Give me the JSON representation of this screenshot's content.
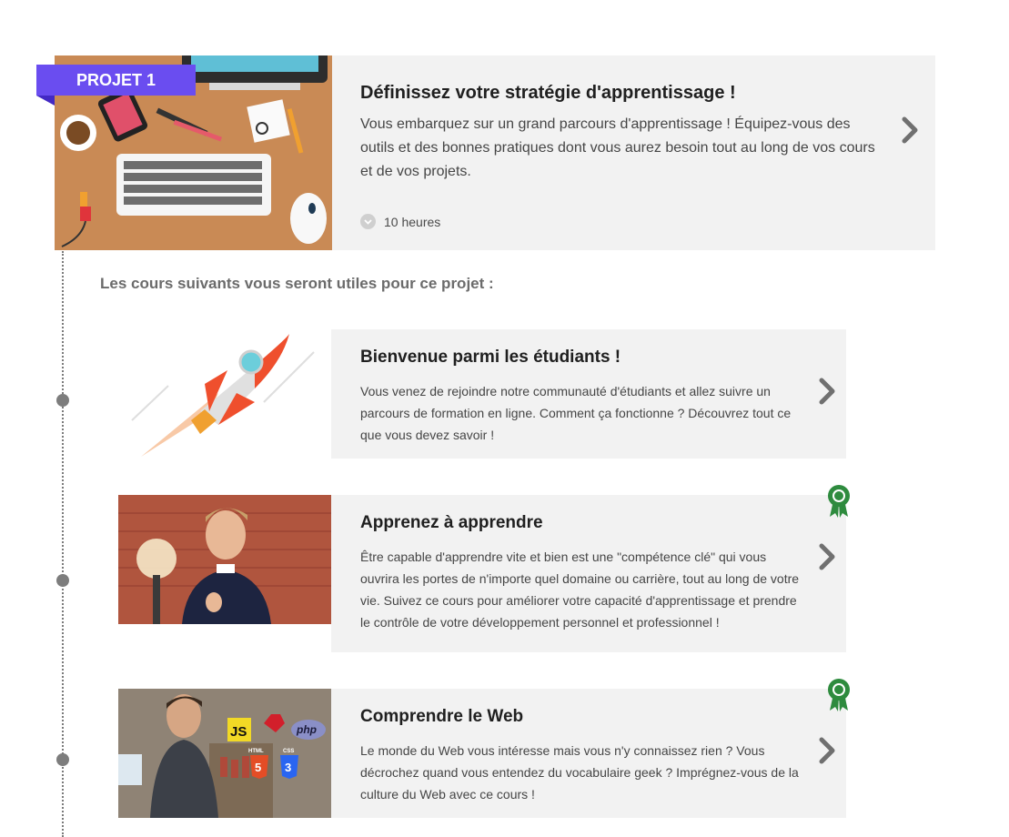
{
  "project": {
    "badge": "PROJET 1",
    "title": "Définissez votre stratégie d'apprentissage !",
    "description": "Vous embarquez sur un grand parcours d'apprentissage ! Équipez-vous des outils et des bonnes pratiques dont vous aurez besoin tout au long de vos cours et de vos projets.",
    "duration": "10 heures",
    "thumbnail_icon": "desk-workspace-illustration"
  },
  "section_title": "Les cours suivants vous seront utiles pour ce projet :",
  "courses": [
    {
      "title": "Bienvenue parmi les étudiants !",
      "description": "Vous venez de rejoindre notre communauté d'étudiants et allez suivre un parcours de formation en ligne. Comment ça fonctionne ? Découvrez tout ce que vous devez savoir !",
      "thumbnail_icon": "rocket-illustration",
      "certified": false
    },
    {
      "title": "Apprenez à apprendre",
      "description": "Être capable d'apprendre vite et bien est une \"compétence clé\" qui vous ouvrira les portes de n'importe quel domaine ou carrière, tout au long de votre vie. Suivez ce cours pour améliorer votre capacité d'apprentissage et prendre le contrôle de votre développement personnel et professionnel !",
      "thumbnail_icon": "instructor-photo",
      "certified": true
    },
    {
      "title": "Comprendre le Web",
      "description": "Le monde du Web vous intéresse mais vous n'y connaissez rien ? Vous décrochez quand vous entendez du vocabulaire geek ? Imprégnez-vous de la culture du Web avec ce cours !",
      "thumbnail_icon": "instructor-web-logos-photo",
      "certified": true,
      "logos": [
        "JS",
        "php",
        "HTML",
        "CSS",
        "5",
        "3"
      ]
    }
  ],
  "colors": {
    "badge": "#6a4df0",
    "card_background": "#f2f2f2",
    "award": "#2e8b3e",
    "chevron": "#707070"
  }
}
